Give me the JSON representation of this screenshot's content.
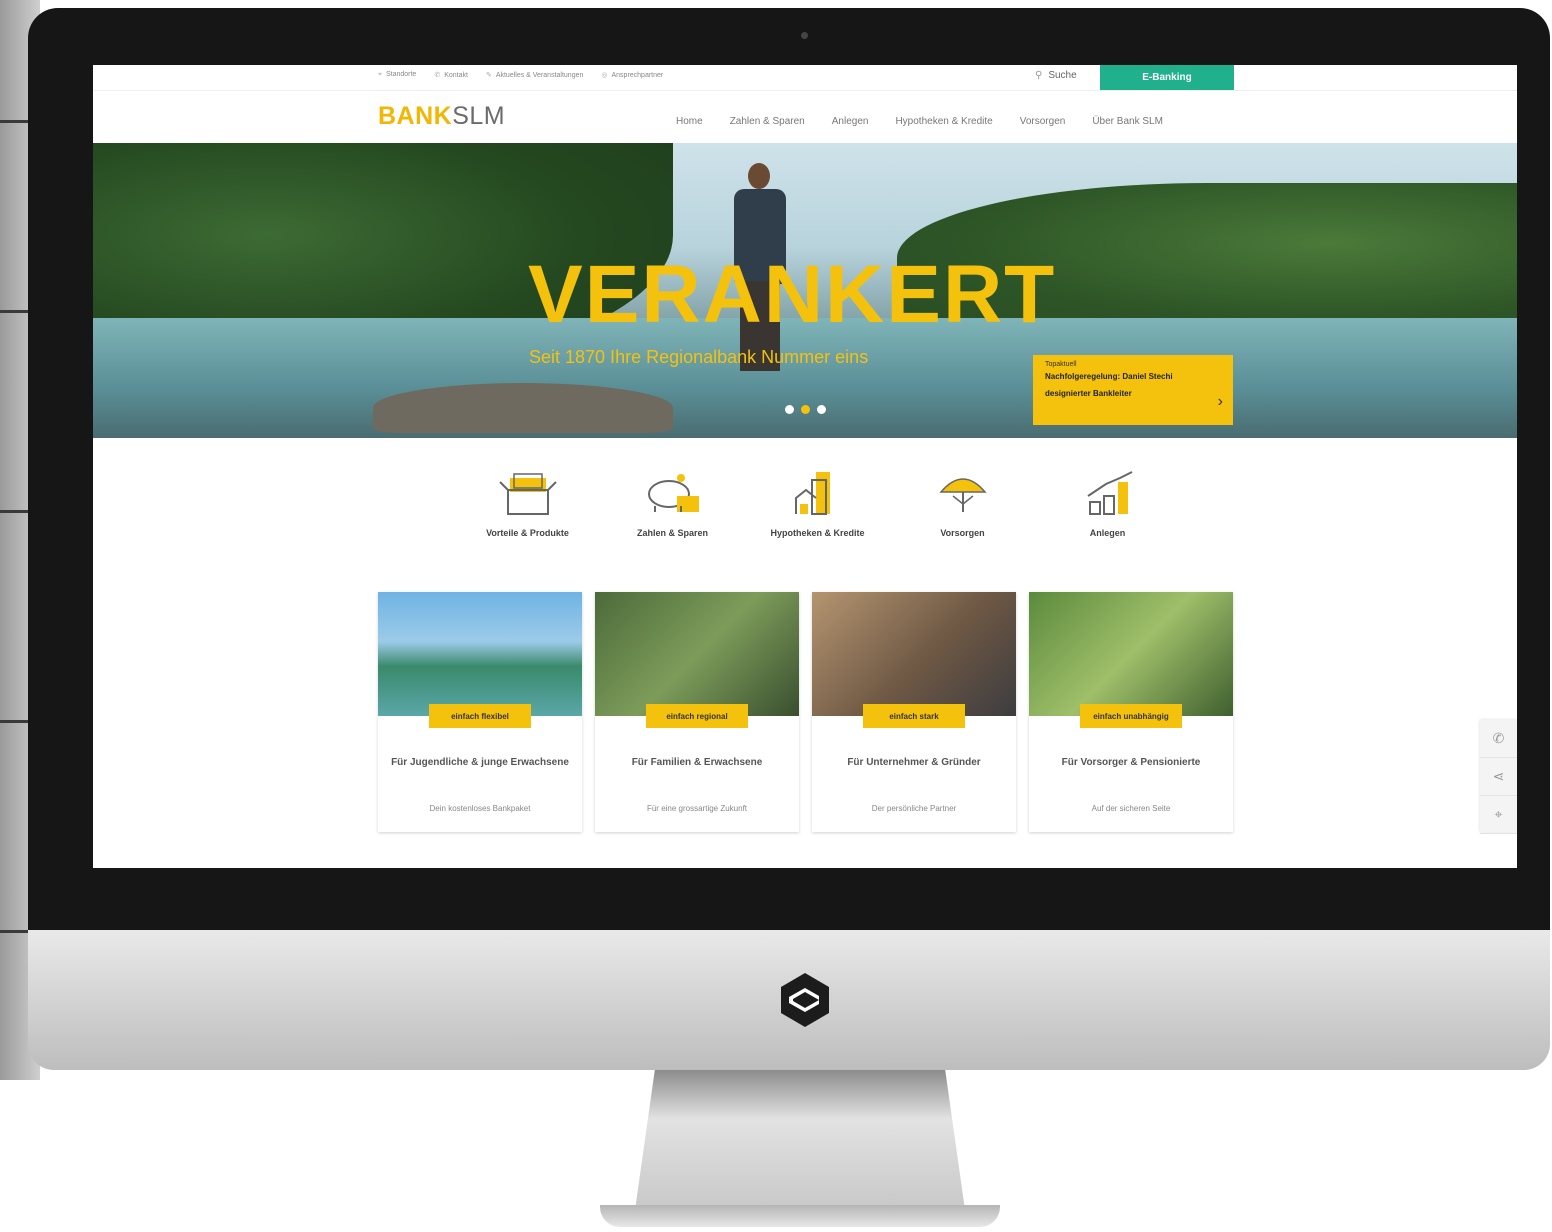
{
  "top_links": [
    {
      "icon": "location-pin-icon",
      "label": "Standorte"
    },
    {
      "icon": "phone-icon",
      "label": "Kontakt"
    },
    {
      "icon": "pen-icon",
      "label": "Aktuelles & Veranstaltungen"
    },
    {
      "icon": "globe-icon",
      "label": "Ansprechpartner"
    }
  ],
  "search_label": "Suche",
  "ebanking_label": "E-Banking",
  "brand": {
    "part1": "BANK",
    "part2": "SLM"
  },
  "nav": [
    "Home",
    "Zahlen & Sparen",
    "Anlegen",
    "Hypotheken & Kredite",
    "Vorsorgen",
    "Über Bank SLM"
  ],
  "hero": {
    "title": "VERANKERT",
    "subtitle": "Seit 1870 Ihre Regionalbank Nummer eins",
    "teaser_label": "Topaktuell",
    "teaser_text": "Nachfolgeregelung: Daniel Stechi designierter Bankleiter",
    "slides": 3,
    "active_slide": 2
  },
  "categories": [
    {
      "icon": "box-products-icon",
      "label": "Vorteile & Produkte"
    },
    {
      "icon": "piggy-bank-icon",
      "label": "Zahlen & Sparen"
    },
    {
      "icon": "buildings-icon",
      "label": "Hypotheken & Kredite"
    },
    {
      "icon": "umbrella-icon",
      "label": "Vorsorgen"
    },
    {
      "icon": "growth-chart-icon",
      "label": "Anlegen"
    }
  ],
  "cards": [
    {
      "tag": "einfach flexibel",
      "title": "Für Jugendliche & junge Erwachsene",
      "subtitle": "Dein kostenloses Bankpaket"
    },
    {
      "tag": "einfach regional",
      "title": "Für Familien & Erwachsene",
      "subtitle": "Für eine grossartige Zukunft"
    },
    {
      "tag": "einfach stark",
      "title": "Für Unternehmer & Gründer",
      "subtitle": "Der persönliche Partner"
    },
    {
      "tag": "einfach unabhängig",
      "title": "Für Vorsorger & Pensionierte",
      "subtitle": "Auf der sicheren Seite"
    }
  ],
  "side_tools": [
    "phone-icon",
    "share-icon",
    "location-pin-icon"
  ],
  "colors": {
    "accent": "#f4c20d",
    "ebanking": "#21b08c"
  }
}
